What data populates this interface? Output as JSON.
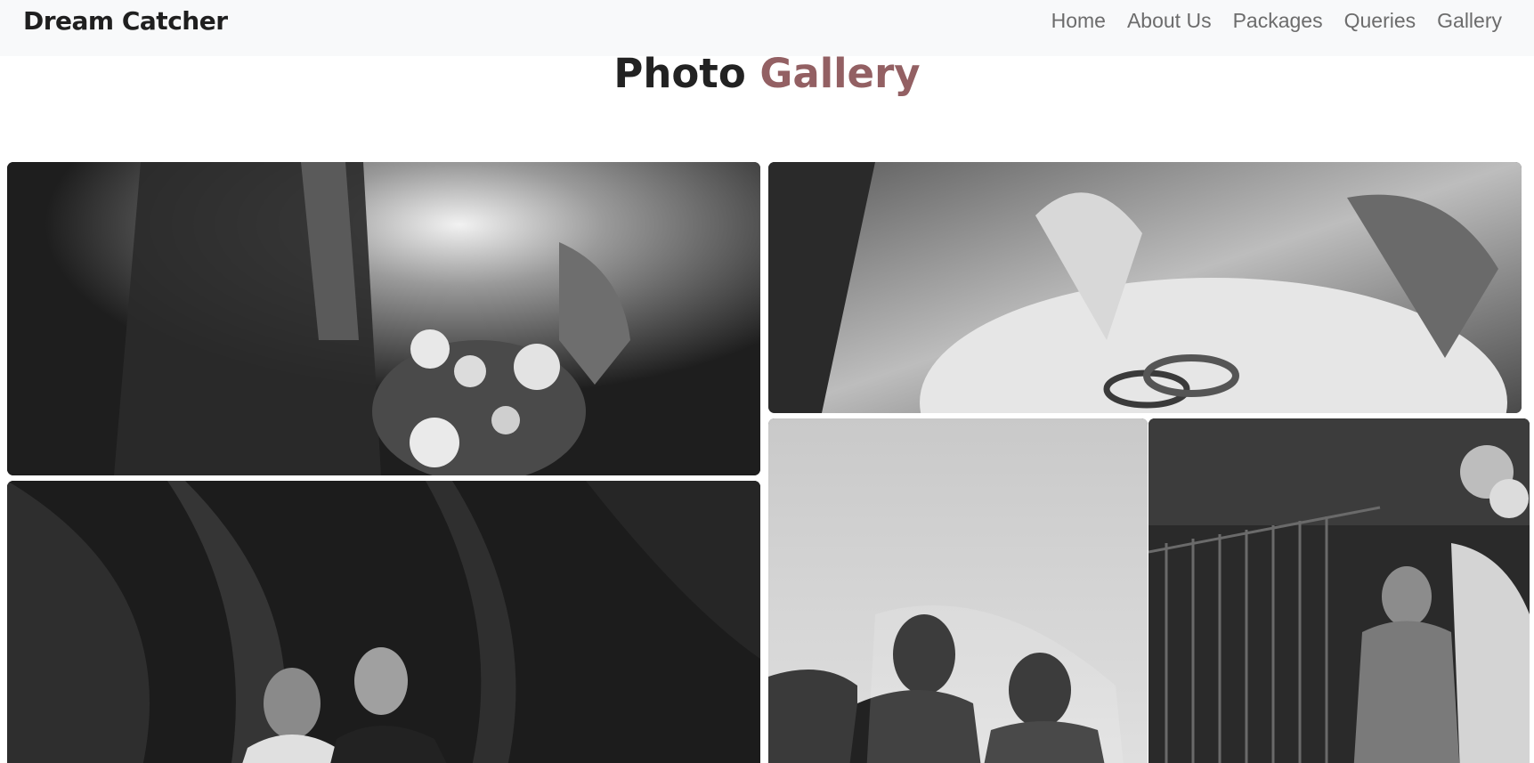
{
  "navbar": {
    "brand": "Dream Catcher",
    "links": [
      "Home",
      "About Us",
      "Packages",
      "Queries",
      "Gallery"
    ]
  },
  "gallery": {
    "title_part1": "Photo",
    "title_part2": "Gallery",
    "accent_color": "#936063"
  }
}
